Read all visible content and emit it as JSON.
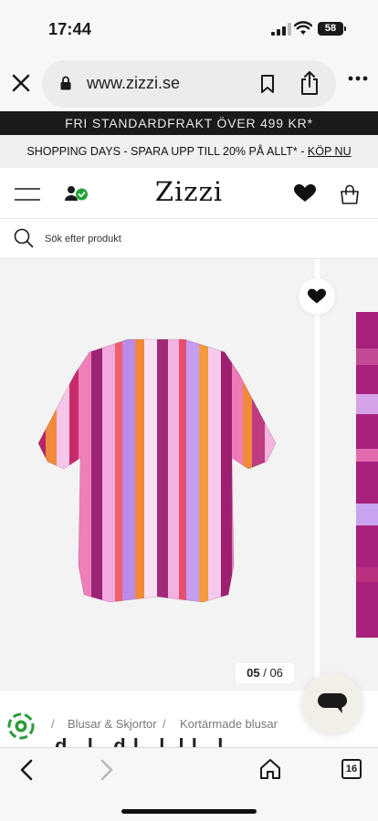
{
  "status_bar": {
    "time": "17:44",
    "battery": "58"
  },
  "browser": {
    "url": "www.zizzi.se",
    "tab_count": "16"
  },
  "banners": {
    "shipping": "FRI STANDARDFRAKT ÖVER 499 KR*",
    "promo_text": "SHOPPING DAYS - SPARA UPP TILL 20% PÅ ALLT* - ",
    "promo_link": "KÖP NU"
  },
  "header": {
    "logo": "Zizzi"
  },
  "search": {
    "placeholder": "Sök efter produkt"
  },
  "gallery": {
    "current": "05",
    "separator": "/",
    "total": "06"
  },
  "breadcrumb": {
    "items": [
      "Blusar & Skjortor",
      "Kortärmade blusar"
    ],
    "separator": "/"
  },
  "product": {
    "title_partial": "d.. l.. d.l.. l. l.l.. l.. "
  },
  "icons": {
    "close": "close-icon",
    "lock": "lock-icon",
    "bookmark": "bookmark-icon",
    "share": "share-icon",
    "more": "more-icon",
    "menu": "menu-icon",
    "account": "account-check-icon",
    "wishlist": "heart-icon",
    "bag": "shopping-bag-icon",
    "search": "search-icon",
    "chat": "chat-icon",
    "back": "chevron-left-icon",
    "forward": "chevron-right-icon",
    "home": "home-icon",
    "tabs": "tabs-icon"
  },
  "colors": {
    "account_check": "#1fa637",
    "black_banner": "#1a1a1a",
    "gallery_bg": "#f3f3f3",
    "eco_badge": "#2d9a3a"
  }
}
